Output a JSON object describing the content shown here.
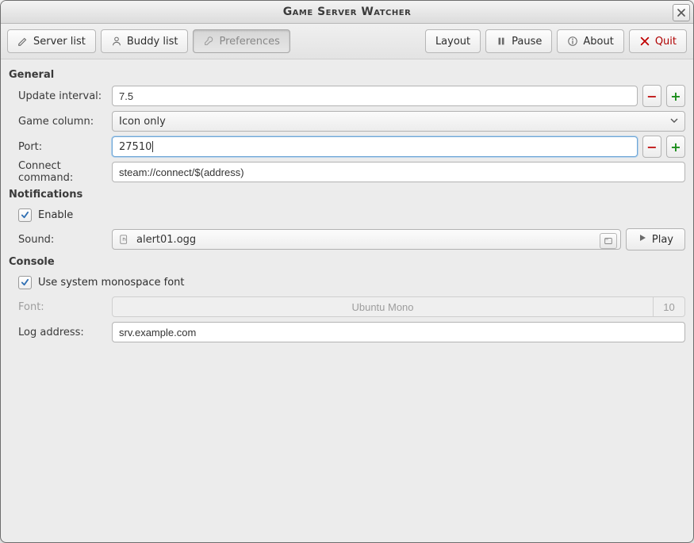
{
  "window": {
    "title": "Game Server Watcher"
  },
  "toolbar": {
    "server_list": "Server list",
    "buddy_list": "Buddy list",
    "preferences": "Preferences",
    "layout": "Layout",
    "pause": "Pause",
    "about": "About",
    "quit": "Quit"
  },
  "groups": {
    "general": "General",
    "notifications": "Notifications",
    "console": "Console"
  },
  "general": {
    "update_interval_label": "Update interval:",
    "update_interval_value": "7.5",
    "game_column_label": "Game column:",
    "game_column_value": "Icon only",
    "port_label": "Port:",
    "port_value": "27510",
    "connect_command_label": "Connect command:",
    "connect_command_value": "steam://connect/$(address)"
  },
  "notifications": {
    "enable_label": "Enable",
    "enable_checked": true,
    "sound_label": "Sound:",
    "sound_file": "alert01.ogg",
    "play_label": "Play"
  },
  "console": {
    "use_mono_label": "Use system monospace font",
    "use_mono_checked": true,
    "font_label": "Font:",
    "font_name": "Ubuntu Mono",
    "font_size": "10",
    "log_address_label": "Log address:",
    "log_address_value": "srv.example.com"
  }
}
